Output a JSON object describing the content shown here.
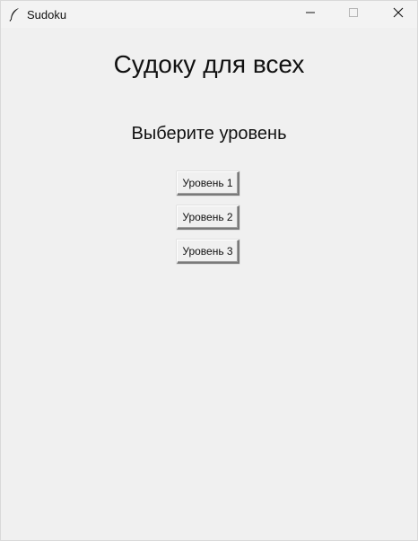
{
  "window": {
    "title": "Sudoku"
  },
  "main": {
    "title": "Судоку для всех",
    "subtitle": "Выберите уровень",
    "levels": [
      {
        "label": "Уровень 1"
      },
      {
        "label": "Уровень 2"
      },
      {
        "label": "Уровень 3"
      }
    ]
  },
  "icons": {
    "app": "feather-icon",
    "minimize": "minimize-icon",
    "maximize": "maximize-icon",
    "close": "close-icon"
  }
}
